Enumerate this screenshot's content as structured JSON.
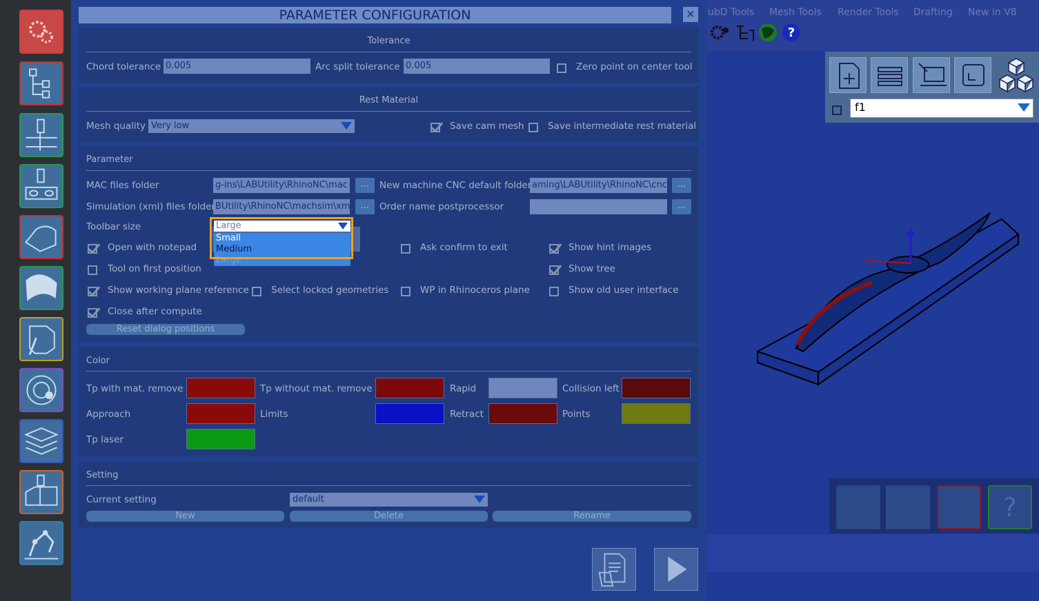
{
  "dialog": {
    "title": "PARAMETER CONFIGURATION",
    "close_glyph": "✕"
  },
  "tolerance": {
    "title": "Tolerance",
    "chord_label": "Chord tolerance",
    "chord_value": "0.005",
    "arc_label": "Arc split tolerance",
    "arc_value": "0.005",
    "zero_point_label": "Zero point on center tool",
    "zero_point_checked": false
  },
  "rest_material": {
    "title": "Rest Material",
    "mesh_quality_label": "Mesh quality",
    "mesh_quality_value": "Very low",
    "save_cam_mesh_label": "Save cam mesh",
    "save_cam_mesh_checked": true,
    "save_intermediate_label": "Save intermediate rest material",
    "save_intermediate_checked": false
  },
  "parameter": {
    "title": "Parameter",
    "mac_folder_label": "MAC files folder",
    "mac_folder_value": "g-ins\\LABUtility\\RhinoNC\\mac",
    "new_machine_label": "New machine CNC default folder",
    "new_machine_value": "aming\\LABUtility\\RhinoNC\\cnc",
    "sim_folder_label": "Simulation (xml) files folder",
    "sim_folder_value": "BUtility\\RhinoNC\\machsim\\xml",
    "order_name_label": "Order name postprocessor",
    "order_name_value": "",
    "dots": "...",
    "toolbar_size_label": "Toolbar size",
    "toolbar_size_value": "Large",
    "toolbar_size_options": [
      "Small",
      "Medium",
      "Large"
    ],
    "open_notepad_label": "Open with notepad",
    "ask_confirm_label": "Ask confirm to exit",
    "show_hint_label": "Show hint images",
    "tool_first_label": "Tool on first position",
    "show_tree_label": "Show tree",
    "show_wp_label": "Show working plane reference",
    "select_locked_label": "Select locked geometries",
    "wp_rhino_label": "WP in Rhinoceros plane",
    "show_old_ui_label": "Show old user interface",
    "close_after_label": "Close after compute",
    "reset_button": "Reset dialog positions"
  },
  "color": {
    "title": "Color",
    "tp_with_label": "Tp with mat. remove",
    "tp_without_label": "Tp without mat. remove",
    "rapid_label": "Rapid",
    "collision_label": "Collision left",
    "approach_label": "Approach",
    "limits_label": "Limits",
    "retract_label": "Retract",
    "points_label": "Points",
    "tp_laser_label": "Tp laser",
    "colors": {
      "tp_with": "#8a0a0a",
      "tp_without": "#7c0a0a",
      "rapid": "#6f87bc",
      "collision": "#5a0a0a",
      "approach": "#8a0a0a",
      "limits": "#0a10c4",
      "retract": "#6a0a0a",
      "points": "#6f7a10",
      "tp_laser": "#0a9a14"
    }
  },
  "setting": {
    "title": "Setting",
    "current_label": "Current setting",
    "current_value": "default",
    "new_button": "New",
    "delete_button": "Delete",
    "rename_button": "Rename"
  },
  "viewport": {
    "menu_items": [
      "ubD Tools",
      "Mesh Tools",
      "Render Tools",
      "Drafting",
      "New in V8"
    ],
    "view_name": "f1"
  },
  "accent": "#f2a21e"
}
